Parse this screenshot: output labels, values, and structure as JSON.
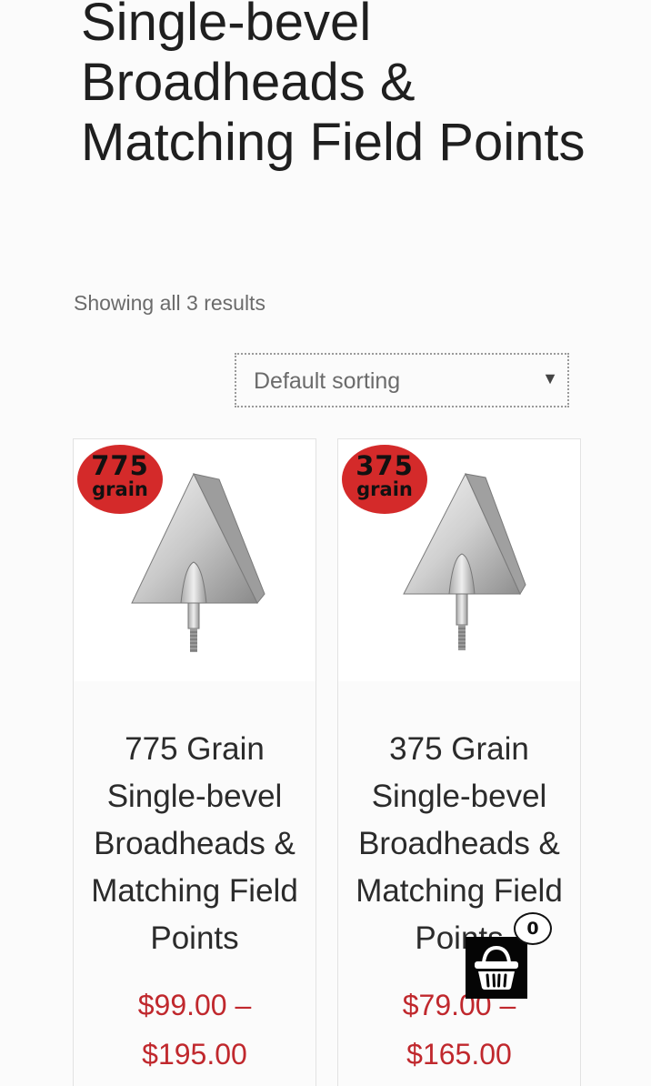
{
  "page": {
    "title": "Single-bevel Broadheads & Matching Field Points",
    "result_count": "Showing all 3 results",
    "sort": {
      "selected": "Default sorting",
      "arrow_icon": "triangle-down-icon"
    }
  },
  "products": [
    {
      "badge_number": "775",
      "badge_unit": "grain",
      "title": "775 Grain Single-bevel Broadheads & Matching Field Points",
      "price_low": "$99.00",
      "price_separator": "–",
      "price_high": "$195.00",
      "badge_color": "#d42a2a"
    },
    {
      "badge_number": "375",
      "badge_unit": "grain",
      "title": "375 Grain Single-bevel Broadheads & Matching Field Points",
      "price_low": "$79.00",
      "price_separator": "–",
      "price_high": "$165.00",
      "badge_color": "#d42a2a"
    }
  ],
  "cart": {
    "icon": "shopping-basket-icon",
    "count": "0"
  },
  "colors": {
    "price": "#c0282d",
    "background": "#fbfbfb"
  }
}
